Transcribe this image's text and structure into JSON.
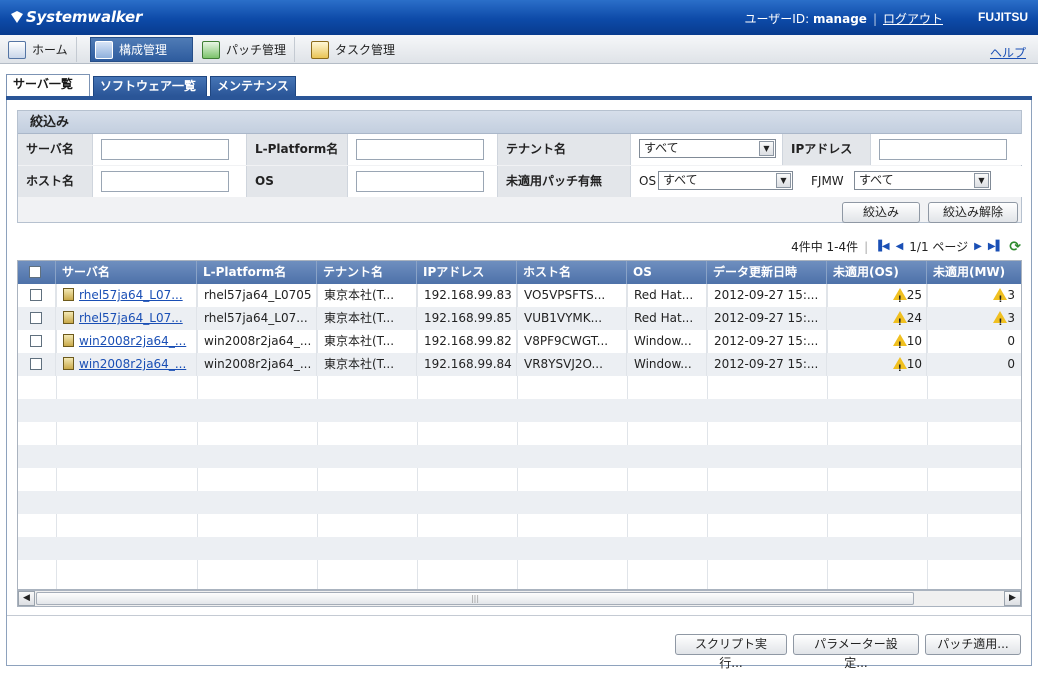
{
  "header": {
    "brand": "Systemwalker",
    "user_label": "ユーザーID:",
    "user_id": "manage",
    "logout": "ログアウト",
    "vendor": "FUJITSU"
  },
  "menu": {
    "items": [
      {
        "label": "ホーム",
        "icon": "home-info-icon"
      },
      {
        "label": "構成管理",
        "icon": "configuration-icon"
      },
      {
        "label": "パッチ管理",
        "icon": "patch-icon"
      },
      {
        "label": "タスク管理",
        "icon": "task-clipboard-icon"
      }
    ],
    "active": "構成管理",
    "help": "ヘルプ"
  },
  "tabs": [
    {
      "label": "サーバ一覧"
    },
    {
      "label": "ソフトウェア一覧"
    },
    {
      "label": "メンテナンス"
    }
  ],
  "filter": {
    "title": "絞込み",
    "server_name_label": "サーバ名",
    "server_name_value": "",
    "lplatform_label": "L-Platform名",
    "lplatform_value": "",
    "tenant_label": "テナント名",
    "tenant_value": "すべて",
    "ip_label": "IPアドレス",
    "ip_value": "",
    "host_label": "ホスト名",
    "host_value": "",
    "os_label": "OS",
    "os_value": "",
    "unapplied_label": "未適用パッチ有無",
    "unapplied_os_label": "OS",
    "unapplied_os_value": "すべて",
    "unapplied_fjmw_label": "FJMW",
    "unapplied_fjmw_value": "すべて",
    "apply_button": "絞込み",
    "clear_button": "絞込み解除"
  },
  "pager": {
    "summary": "4件中 1-4件",
    "page": "1/1 ページ"
  },
  "grid": {
    "columns": [
      "サーバ名",
      "L-Platform名",
      "テナント名",
      "IPアドレス",
      "ホスト名",
      "OS",
      "データ更新日時",
      "未適用(OS)",
      "未適用(MW)"
    ],
    "rows": [
      {
        "server": "rhel57ja64_L07...",
        "lplatform": "rhel57ja64_L0705",
        "tenant": "東京本社(T...",
        "ip": "192.168.99.83",
        "host": "VO5VPSFTS...",
        "os": "Red Hat...",
        "updated": "2012-09-27 15:...",
        "os_unapplied": "25",
        "os_warn": true,
        "mw_unapplied": "3",
        "mw_warn": true
      },
      {
        "server": "rhel57ja64_L07...",
        "lplatform": "rhel57ja64_L07...",
        "tenant": "東京本社(T...",
        "ip": "192.168.99.85",
        "host": "VUB1VYMK...",
        "os": "Red Hat...",
        "updated": "2012-09-27 15:...",
        "os_unapplied": "24",
        "os_warn": true,
        "mw_unapplied": "3",
        "mw_warn": true
      },
      {
        "server": "win2008r2ja64_...",
        "lplatform": "win2008r2ja64_...",
        "tenant": "東京本社(T...",
        "ip": "192.168.99.82",
        "host": "V8PF9CWGT...",
        "os": "Window...",
        "updated": "2012-09-27 15:...",
        "os_unapplied": "10",
        "os_warn": true,
        "mw_unapplied": "0",
        "mw_warn": false
      },
      {
        "server": "win2008r2ja64_...",
        "lplatform": "win2008r2ja64_...",
        "tenant": "東京本社(T...",
        "ip": "192.168.99.84",
        "host": "VR8YSVJ2O...",
        "os": "Window...",
        "updated": "2012-09-27 15:...",
        "os_unapplied": "10",
        "os_warn": true,
        "mw_unapplied": "0",
        "mw_warn": false
      }
    ]
  },
  "footer": {
    "script_button": "スクリプト実行...",
    "param_button": "パラメーター設定...",
    "patch_button": "パッチ適用..."
  }
}
